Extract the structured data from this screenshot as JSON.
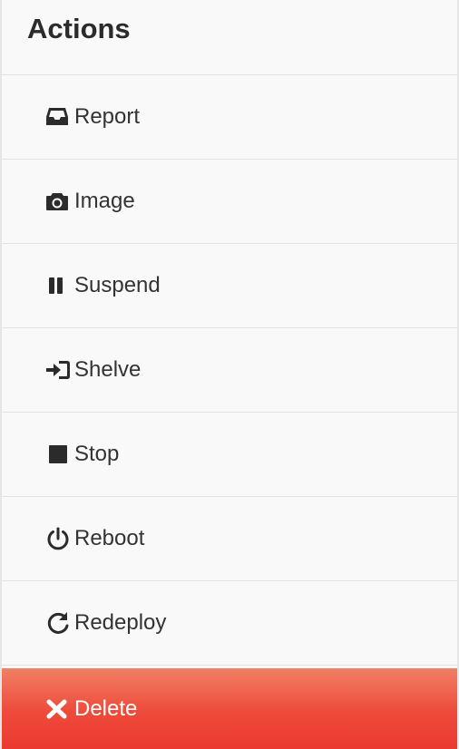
{
  "panel": {
    "title": "Actions"
  },
  "actions": [
    {
      "label": "Report",
      "icon": "inbox-icon"
    },
    {
      "label": "Image",
      "icon": "camera-icon"
    },
    {
      "label": "Suspend",
      "icon": "pause-icon"
    },
    {
      "label": "Shelve",
      "icon": "sign-in-icon"
    },
    {
      "label": "Stop",
      "icon": "stop-icon"
    },
    {
      "label": "Reboot",
      "icon": "power-icon"
    },
    {
      "label": "Redeploy",
      "icon": "refresh-icon"
    },
    {
      "label": "Delete",
      "icon": "close-icon"
    }
  ],
  "colors": {
    "delete_background": "#ee4a3a",
    "text": "#333333",
    "panel_background": "#f9f9f9"
  }
}
